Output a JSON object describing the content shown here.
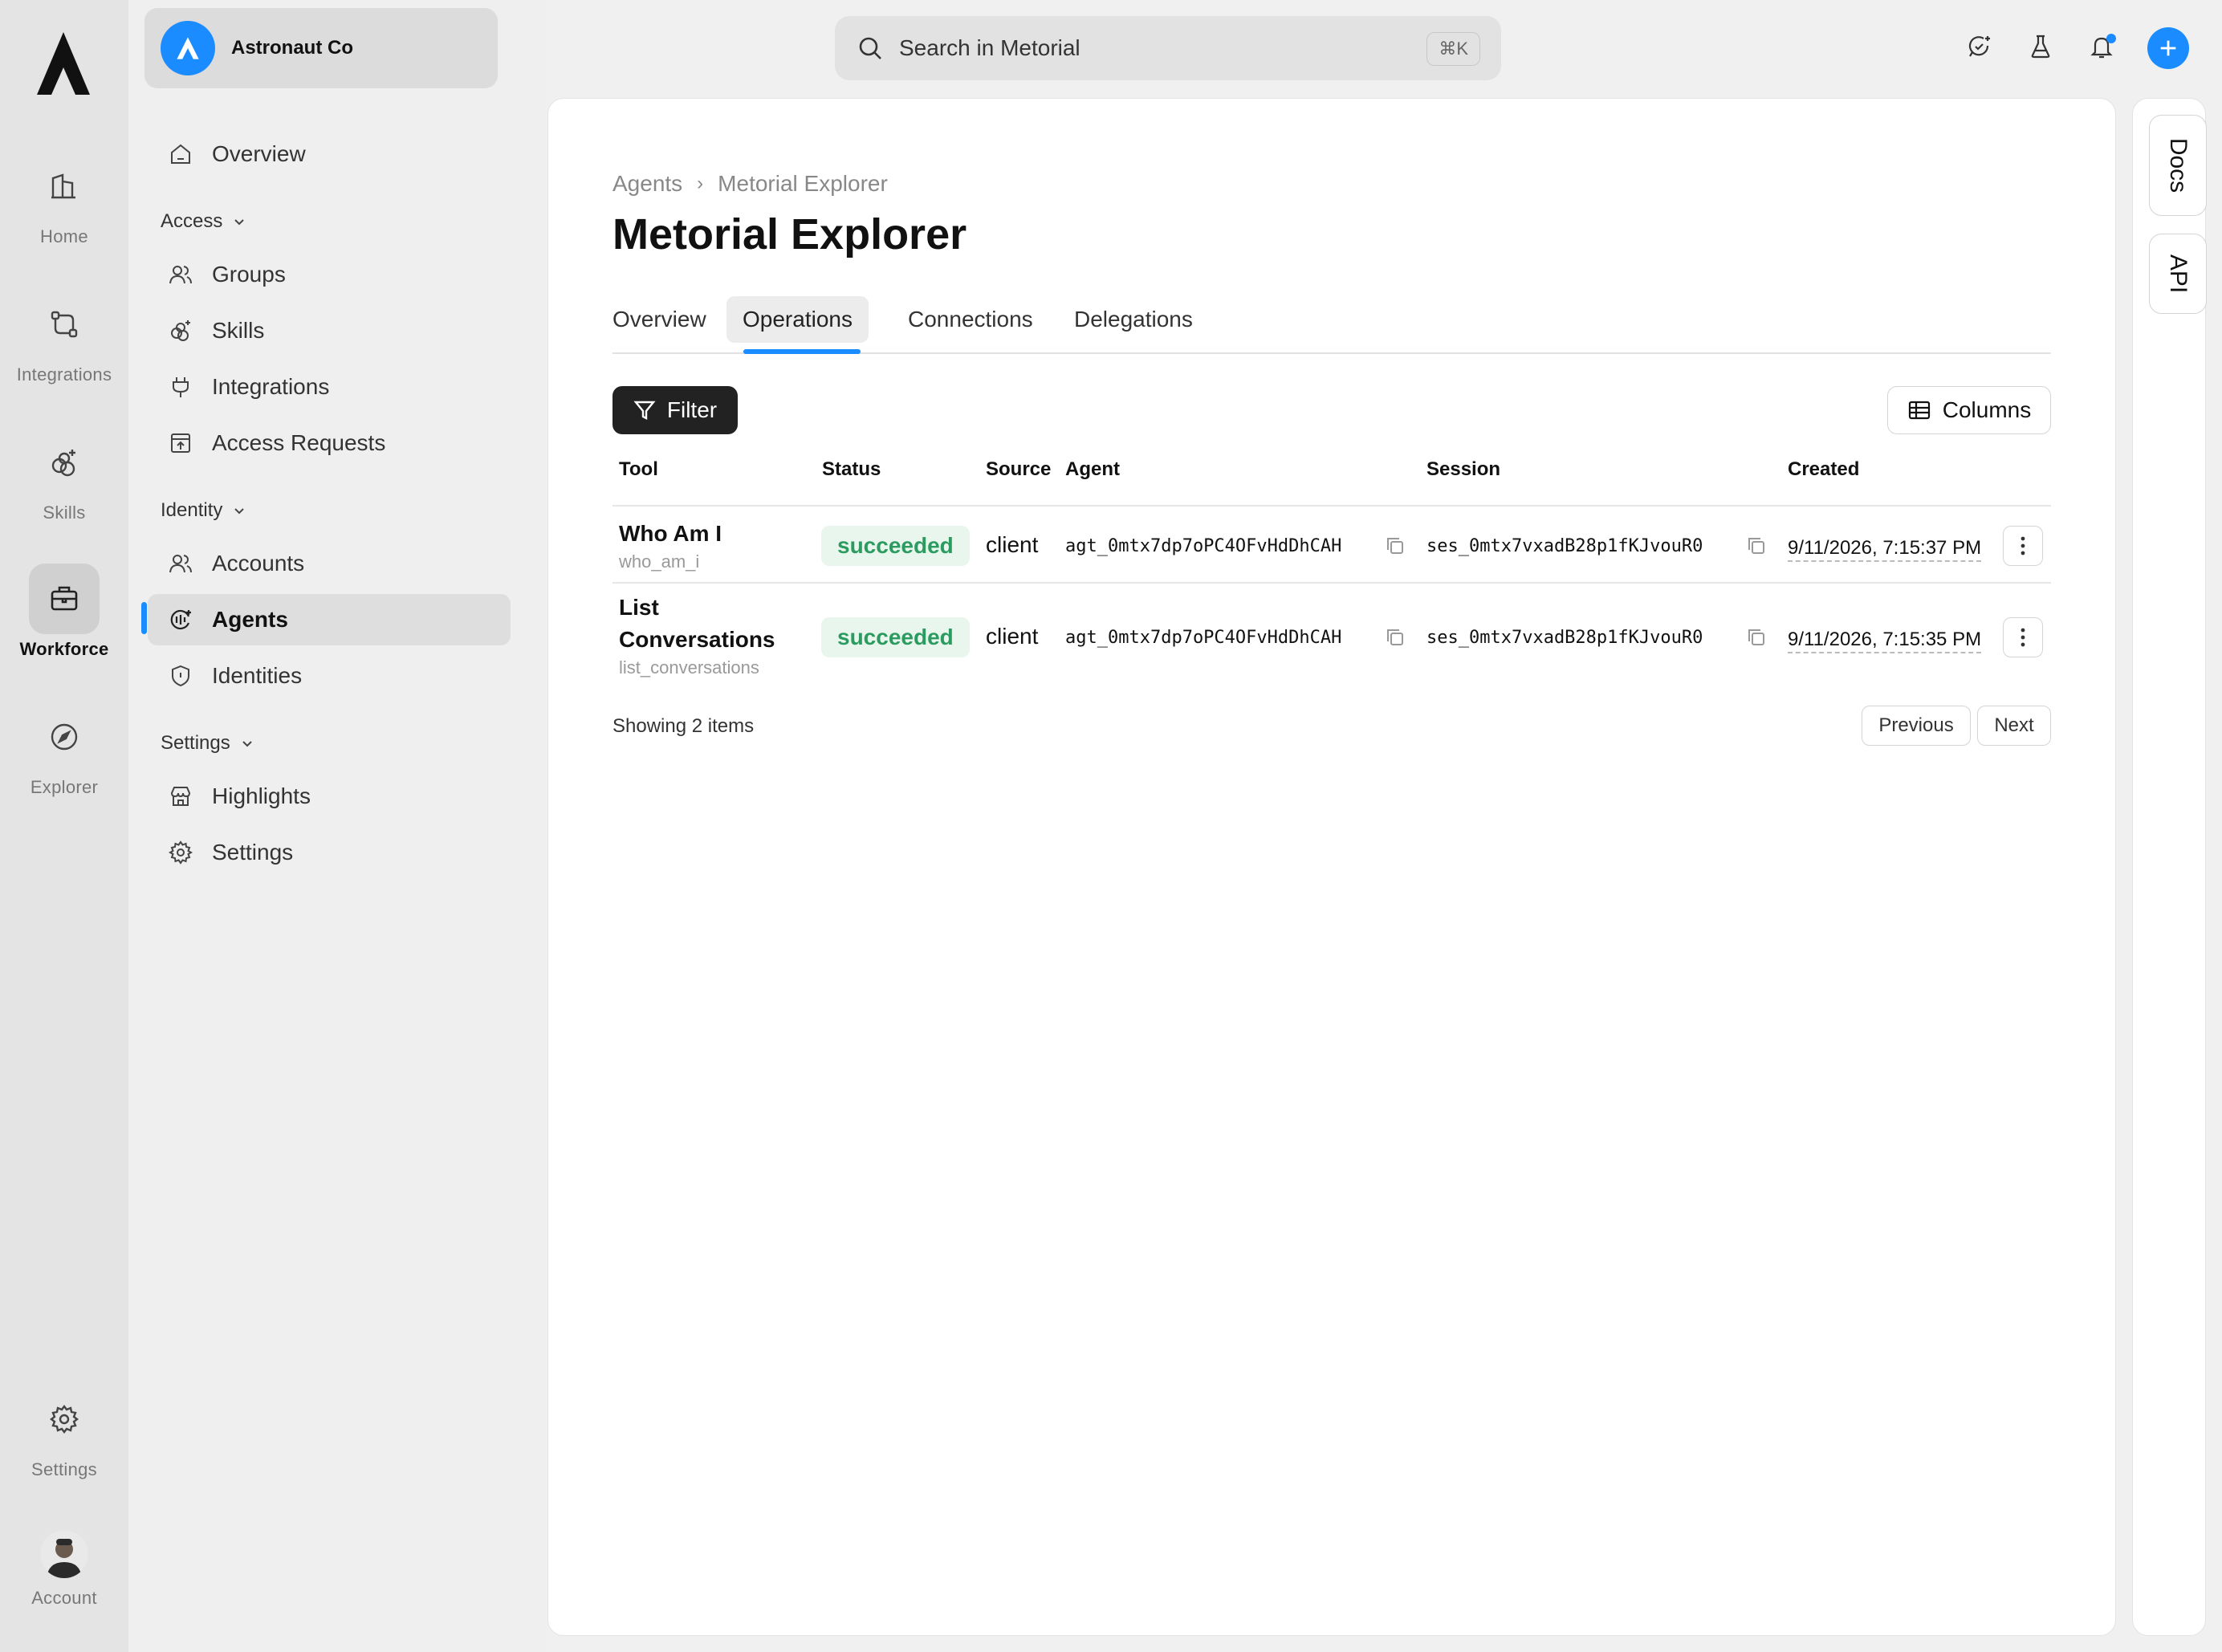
{
  "org": {
    "name": "Astronaut Co"
  },
  "rail": {
    "items": [
      {
        "label": "Home",
        "icon": "home-icon"
      },
      {
        "label": "Integrations",
        "icon": "integrations-icon"
      },
      {
        "label": "Skills",
        "icon": "skills-icon"
      },
      {
        "label": "Workforce",
        "icon": "briefcase-icon",
        "active": true
      },
      {
        "label": "Explorer",
        "icon": "compass-icon"
      },
      {
        "label": "Settings",
        "icon": "gear-icon"
      },
      {
        "label": "Account",
        "icon": "avatar"
      }
    ]
  },
  "sidebar": {
    "overview": "Overview",
    "access_header": "Access",
    "access_items": [
      "Groups",
      "Skills",
      "Integrations",
      "Access Requests"
    ],
    "identity_header": "Identity",
    "identity_items": [
      "Accounts",
      "Agents",
      "Identities"
    ],
    "settings_header": "Settings",
    "settings_items": [
      "Highlights",
      "Settings"
    ],
    "active": "Agents"
  },
  "search": {
    "placeholder": "Search in Metorial",
    "shortcut": "⌘K"
  },
  "breadcrumb": [
    "Agents",
    "Metorial Explorer"
  ],
  "page": {
    "title": "Metorial Explorer"
  },
  "tabs": [
    "Overview",
    "Operations",
    "Connections",
    "Delegations"
  ],
  "active_tab": "Operations",
  "toolbar": {
    "filter": "Filter",
    "columns": "Columns"
  },
  "table": {
    "headers": [
      "Tool",
      "Status",
      "Source",
      "Agent",
      "Session",
      "Created"
    ],
    "rows": [
      {
        "tool": "Who Am I",
        "tool_id": "who_am_i",
        "status": "succeeded",
        "source": "client",
        "agent": "agt_0mtx7dp7oPC4OFvHdDhCAH",
        "session": "ses_0mtx7vxadB28p1fKJvouR0",
        "created": "9/11/2026, 7:15:37 PM"
      },
      {
        "tool_line1": "List",
        "tool_line2": "Conversations",
        "tool_id": "list_conversations",
        "status": "succeeded",
        "source": "client",
        "agent": "agt_0mtx7dp7oPC4OFvHdDhCAH",
        "session": "ses_0mtx7vxadB28p1fKJvouR0",
        "created": "9/11/2026, 7:15:35 PM"
      }
    ]
  },
  "footer": {
    "showing": "Showing 2 items",
    "previous": "Previous",
    "next": "Next"
  },
  "dock": {
    "docs": "Docs",
    "api": "API"
  },
  "colors": {
    "accent": "#1a8cff",
    "success_bg": "#e8f6ee",
    "success_text": "#2c9b5f"
  }
}
